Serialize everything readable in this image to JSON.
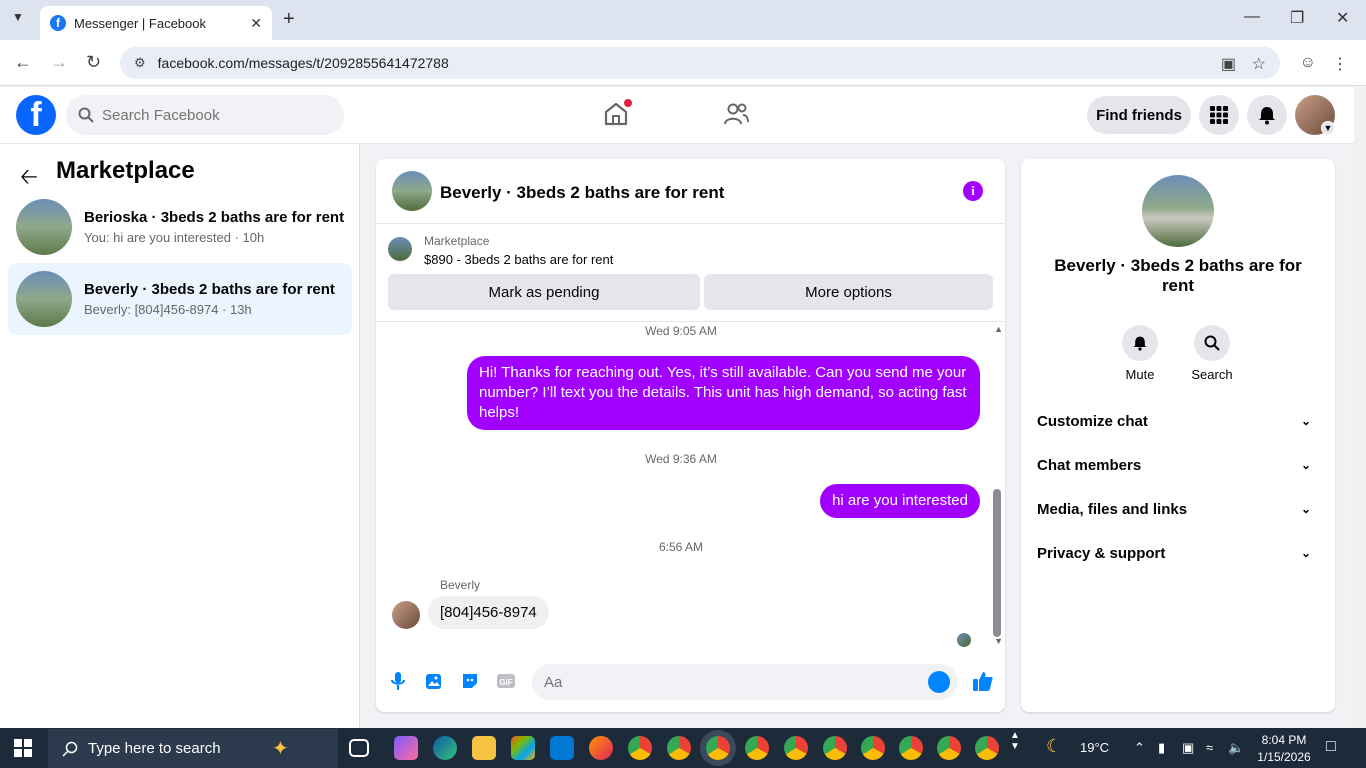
{
  "browser": {
    "tab_title": "Messenger | Facebook",
    "url": "facebook.com/messages/t/2092855641472788"
  },
  "fb": {
    "search_placeholder": "Search Facebook",
    "find_friends": "Find friends"
  },
  "sidebar": {
    "title": "Marketplace",
    "conversations": [
      {
        "title": "Berioska · 3beds 2 baths are for rent",
        "preview": "You: hi are you interested · 10h"
      },
      {
        "title": "Beverly · 3beds 2 baths are for rent",
        "preview": "Beverly: [804]456-8974 · 13h"
      }
    ]
  },
  "chat": {
    "title": "Beverly · 3beds 2 baths are for rent",
    "marketplace_label": "Marketplace",
    "listing": "$890 - 3beds 2 baths are for rent",
    "mark_pending": "Mark as pending",
    "more_options": "More options",
    "messages": [
      {
        "time": "Wed 9:05 AM",
        "text": "Hi! Thanks for reaching out. Yes, it’s still available. Can you send me your number? I’ll text you the details. This unit has high demand, so acting fast helps!"
      },
      {
        "time": "Wed 9:36 AM",
        "text": "hi are you interested"
      },
      {
        "time": "6:56 AM",
        "sender": "Beverly",
        "text": "[804]456-8974"
      }
    ],
    "input_placeholder": "Aa"
  },
  "info": {
    "name": "Beverly · 3beds 2 baths are for rent",
    "mute": "Mute",
    "search": "Search",
    "sections": [
      "Customize chat",
      "Chat members",
      "Media, files and links",
      "Privacy & support"
    ]
  },
  "taskbar": {
    "search_placeholder": "Type here to search",
    "weather": "19°C",
    "time": "8:04 PM",
    "date": "1/15/2026"
  },
  "colors": {
    "accent": "#a100ff",
    "fb_blue": "#0866ff",
    "active_conv": "#ebf5ff"
  }
}
